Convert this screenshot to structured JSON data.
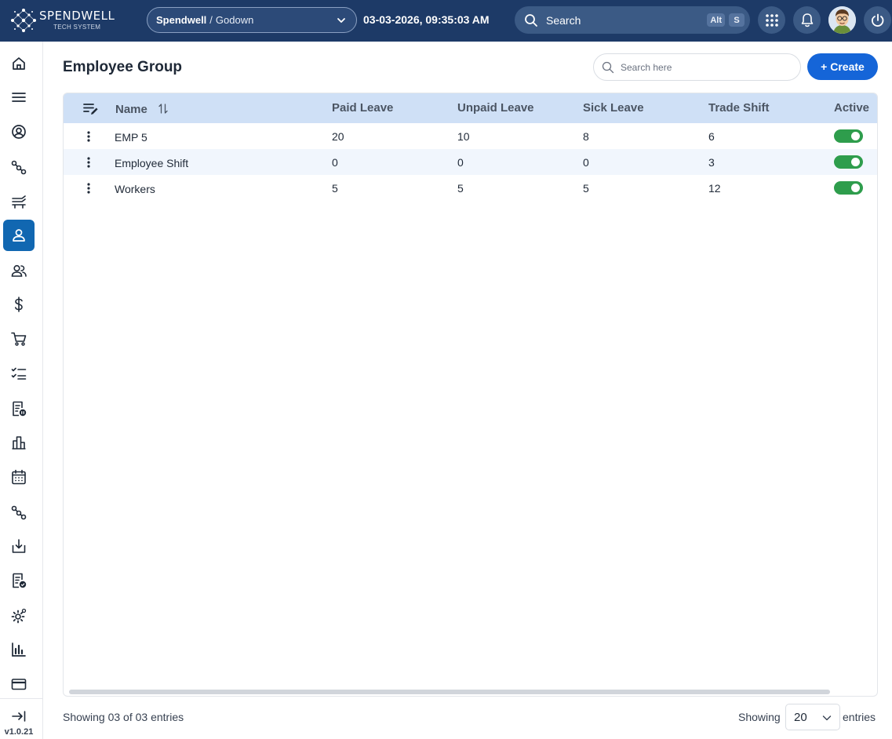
{
  "brand": {
    "name": "SPENDWELL",
    "tagline": "TECH SYSTEM"
  },
  "header": {
    "company": "Spendwell",
    "separator": "/",
    "location": "Godown",
    "datetime": "03-03-2026, 09:35:03 AM",
    "search_label": "Search",
    "shortcut_keys": [
      "Alt",
      "S"
    ]
  },
  "sidebar": {
    "items": [
      {
        "icon": "home-icon"
      },
      {
        "icon": "menu-icon"
      },
      {
        "icon": "support-icon"
      },
      {
        "icon": "workflow-icon"
      },
      {
        "icon": "inventory-icon"
      },
      {
        "icon": "employee-icon",
        "active": true
      },
      {
        "icon": "users-icon"
      },
      {
        "icon": "dollar-icon"
      },
      {
        "icon": "cart-icon"
      },
      {
        "icon": "checklist-icon"
      },
      {
        "icon": "report-pause-icon"
      },
      {
        "icon": "building-icon"
      },
      {
        "icon": "calendar-icon"
      },
      {
        "icon": "workflow-icon"
      },
      {
        "icon": "download-icon"
      },
      {
        "icon": "document-check-icon"
      },
      {
        "icon": "settings-gear-icon"
      },
      {
        "icon": "bar-chart-icon"
      },
      {
        "icon": "credit-card-icon"
      }
    ],
    "version": "v1.0.21"
  },
  "page": {
    "title": "Employee Group",
    "search_placeholder": "Search here",
    "create_label": "+ Create"
  },
  "table": {
    "columns": [
      "Name",
      "Paid Leave",
      "Unpaid Leave",
      "Sick Leave",
      "Trade Shift",
      "Active"
    ],
    "rows": [
      {
        "name": "EMP 5",
        "paid_leave": "20",
        "unpaid_leave": "10",
        "sick_leave": "8",
        "trade_shift": "6",
        "active": true
      },
      {
        "name": "Employee Shift",
        "paid_leave": "0",
        "unpaid_leave": "0",
        "sick_leave": "0",
        "trade_shift": "3",
        "active": true
      },
      {
        "name": "Workers",
        "paid_leave": "5",
        "unpaid_leave": "5",
        "sick_leave": "5",
        "trade_shift": "12",
        "active": true
      }
    ]
  },
  "footer": {
    "summary": "Showing 03 of 03 entries",
    "showing_label": "Showing",
    "page_size": "20",
    "entries_label": "entries"
  },
  "colors": {
    "topbar": "#1d3a67",
    "accent": "#1565d8",
    "active_sidebar": "#1167b1",
    "header_row": "#cfe0f6",
    "toggle_on": "#2e9d4c"
  }
}
